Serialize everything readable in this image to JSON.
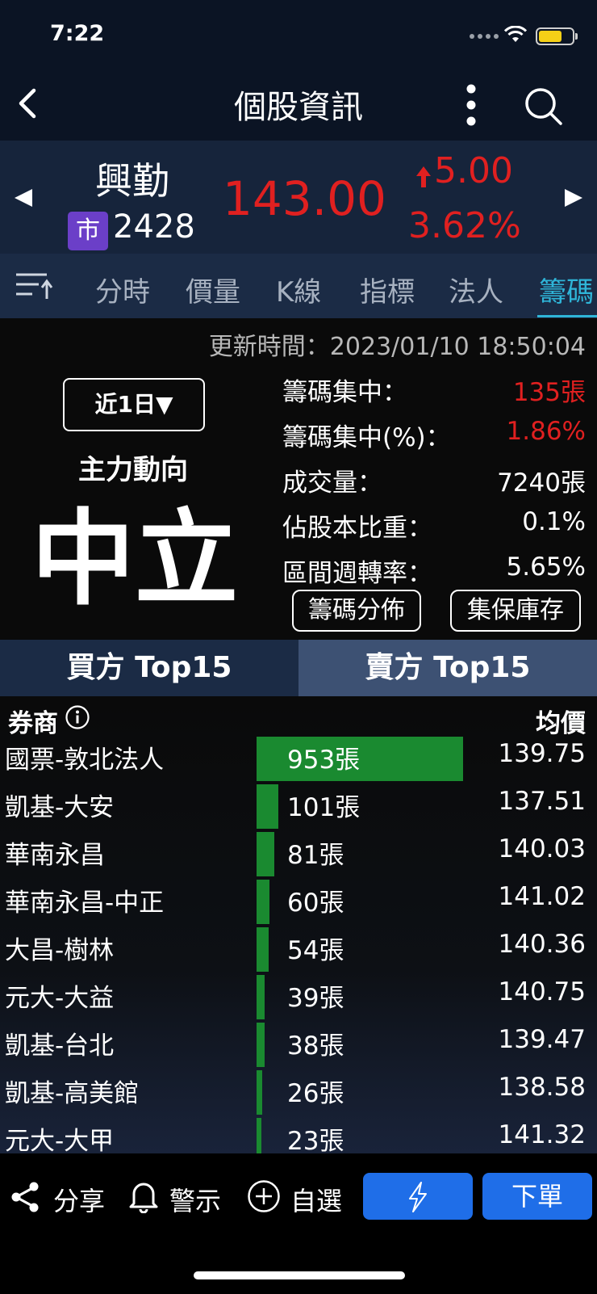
{
  "status": {
    "time": "7:22"
  },
  "nav": {
    "title": "個股資訊"
  },
  "stock": {
    "name": "興勤",
    "market_badge": "市",
    "code": "2428",
    "price": "143.00",
    "change": "5.00",
    "change_pct": "3.62%"
  },
  "tabs": [
    {
      "label": "分時"
    },
    {
      "label": "價量"
    },
    {
      "label": "K線"
    },
    {
      "label": "指標"
    },
    {
      "label": "法人"
    },
    {
      "label": "籌碼"
    }
  ],
  "summary": {
    "update_time": "更新時間：2023/01/10 18:50:04",
    "period_label": "近1日▼",
    "trend_label": "主力動向",
    "trend_value": "中立",
    "stats": [
      {
        "label": "籌碼集中：",
        "value": "135張"
      },
      {
        "label": "籌碼集中(%)：",
        "value": "1.86%"
      },
      {
        "label": "成交量：",
        "value": "7240張"
      },
      {
        "label": "佔股本比重：",
        "value": "0.1%"
      },
      {
        "label": "區間週轉率：",
        "value": "5.65%"
      }
    ],
    "distribution_button": "籌碼分佈",
    "custody_button": "集保庫存"
  },
  "buy_sell_tabs": {
    "buy": "買方 Top15",
    "sell": "賣方 Top15"
  },
  "table": {
    "col_broker": "券商",
    "col_avg_price": "均價",
    "rows": [
      {
        "broker": "國票-敦北法人",
        "volume": "953張",
        "volume_num": 953,
        "avg_price": "139.75"
      },
      {
        "broker": "凱基-大安",
        "volume": "101張",
        "volume_num": 101,
        "avg_price": "137.51"
      },
      {
        "broker": "華南永昌",
        "volume": "81張",
        "volume_num": 81,
        "avg_price": "140.03"
      },
      {
        "broker": "華南永昌-中正",
        "volume": "60張",
        "volume_num": 60,
        "avg_price": "141.02"
      },
      {
        "broker": "大昌-樹林",
        "volume": "54張",
        "volume_num": 54,
        "avg_price": "140.36"
      },
      {
        "broker": "元大-大益",
        "volume": "39張",
        "volume_num": 39,
        "avg_price": "140.75"
      },
      {
        "broker": "凱基-台北",
        "volume": "38張",
        "volume_num": 38,
        "avg_price": "139.47"
      },
      {
        "broker": "凱基-高美館",
        "volume": "26張",
        "volume_num": 26,
        "avg_price": "138.58"
      },
      {
        "broker": "元大-大甲",
        "volume": "23張",
        "volume_num": 23,
        "avg_price": "141.32"
      }
    ]
  },
  "bottom": {
    "share": "分享",
    "alert": "警示",
    "watchlist": "自選",
    "order": "下單"
  },
  "colors": {
    "up": "#e02020",
    "accent": "#2fb5d8",
    "bar": "#1a8a30",
    "button": "#1f6ee8"
  }
}
